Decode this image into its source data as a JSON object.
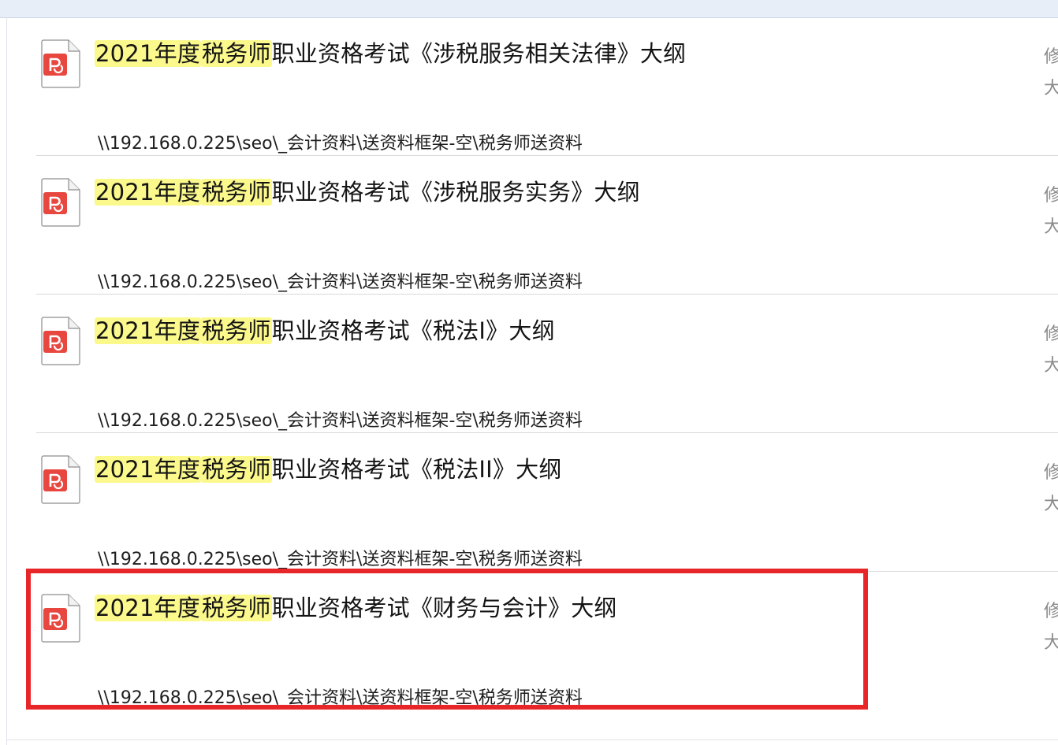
{
  "results": [
    {
      "title_parts": [
        "2021年度",
        "税务师",
        "职业资格考试《涉税服务相关法律》大纲"
      ],
      "path": "\\\\192.168.0.225\\seo\\_会计资料\\送资料框架-空\\税务师送资料",
      "meta_modified": "修",
      "meta_size": "大"
    },
    {
      "title_parts": [
        "2021年度",
        "税务师",
        "职业资格考试《涉税服务实务》大纲"
      ],
      "path": "\\\\192.168.0.225\\seo\\_会计资料\\送资料框架-空\\税务师送资料",
      "meta_modified": "修",
      "meta_size": "大"
    },
    {
      "title_parts": [
        "2021年度",
        "税务师",
        "职业资格考试《税法I》大纲"
      ],
      "path": "\\\\192.168.0.225\\seo\\_会计资料\\送资料框架-空\\税务师送资料",
      "meta_modified": "修",
      "meta_size": "大"
    },
    {
      "title_parts": [
        "2021年度",
        "税务师",
        "职业资格考试《税法II》大纲"
      ],
      "path": "\\\\192.168.0.225\\seo\\_会计资料\\送资料框架-空\\税务师送资料",
      "meta_modified": "修",
      "meta_size": "大"
    },
    {
      "title_parts": [
        "2021年度",
        "税务师",
        "职业资格考试《财务与会计》大纲"
      ],
      "path": "\\\\192.168.0.225\\seo\\_会计资料\\送资料框架-空\\税务师送资料",
      "meta_modified": "修",
      "meta_size": "大"
    }
  ],
  "icons": {
    "file_type": "pdf-file-icon"
  },
  "colors": {
    "highlight": "#fbf88c",
    "annotation_box": "#e8262a",
    "pdf_red": "#e8473f"
  }
}
